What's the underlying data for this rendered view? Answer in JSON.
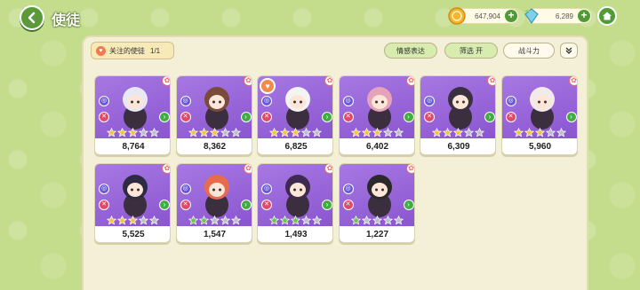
{
  "header": {
    "title": "使徒",
    "gold": "647,904",
    "gems": "6,289"
  },
  "toolbar": {
    "favorite_label": "关注的使徒",
    "favorite_count": "1/1",
    "emote_label": "情感表达",
    "filter_label": "筛选 开",
    "power_label": "战斗力"
  },
  "colors": {
    "gold_star": "#f5c23a",
    "green_star": "#6cc24a",
    "empty_star": "#b9bfc8",
    "card_purple": "#9a66d9"
  },
  "cards": [
    {
      "power": "8,764",
      "stars": 3,
      "star_color": "gold",
      "favorite": false
    },
    {
      "power": "8,362",
      "stars": 3,
      "star_color": "gold",
      "favorite": false
    },
    {
      "power": "6,825",
      "stars": 3,
      "star_color": "gold",
      "favorite": true
    },
    {
      "power": "6,402",
      "stars": 3,
      "star_color": "gold",
      "favorite": false
    },
    {
      "power": "6,309",
      "stars": 3,
      "star_color": "gold",
      "favorite": false
    },
    {
      "power": "5,960",
      "stars": 3,
      "star_color": "gold",
      "favorite": false
    },
    {
      "power": "5,525",
      "stars": 3,
      "star_color": "gold",
      "favorite": false
    },
    {
      "power": "1,547",
      "stars": 2,
      "star_color": "green",
      "favorite": false
    },
    {
      "power": "1,493",
      "stars": 3,
      "star_color": "green",
      "favorite": false
    },
    {
      "power": "1,227",
      "stars": 1,
      "star_color": "green",
      "favorite": false
    }
  ]
}
